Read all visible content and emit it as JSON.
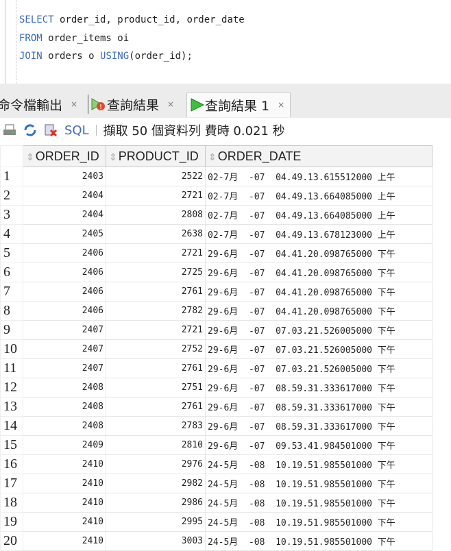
{
  "editor": {
    "lines": [
      [
        {
          "t": "SELECT",
          "kw": true
        },
        {
          "t": " order_id, product_id, order_date",
          "kw": false
        }
      ],
      [
        {
          "t": "FROM",
          "kw": true
        },
        {
          "t": " order_items oi",
          "kw": false
        }
      ],
      [
        {
          "t": "JOIN",
          "kw": true
        },
        {
          "t": " orders o ",
          "kw": false
        },
        {
          "t": "USING",
          "kw": true
        },
        {
          "t": "(order_id);",
          "kw": false
        }
      ]
    ]
  },
  "tabs": [
    {
      "label": "命令檔輸出",
      "icon": "none",
      "close": "×"
    },
    {
      "label": "查詢結果",
      "icon": "query-error-icon",
      "close": "×"
    },
    {
      "label": "查詢結果 1",
      "icon": "run-icon",
      "close": "×",
      "active": true
    }
  ],
  "toolbar": {
    "sql_label": "SQL",
    "status": "擷取 50 個資料列 費時 0.021 秒"
  },
  "columns": [
    "ORDER_ID",
    "PRODUCT_ID",
    "ORDER_DATE"
  ],
  "rows": [
    [
      "1",
      "2403",
      "2522",
      "02-7月  -07  04.49.13.615512000 上午"
    ],
    [
      "2",
      "2404",
      "2721",
      "02-7月  -07  04.49.13.664085000 上午"
    ],
    [
      "3",
      "2404",
      "2808",
      "02-7月  -07  04.49.13.664085000 上午"
    ],
    [
      "4",
      "2405",
      "2638",
      "02-7月  -07  04.49.13.678123000 上午"
    ],
    [
      "5",
      "2406",
      "2721",
      "29-6月  -07  04.41.20.098765000 下午"
    ],
    [
      "6",
      "2406",
      "2725",
      "29-6月  -07  04.41.20.098765000 下午"
    ],
    [
      "7",
      "2406",
      "2761",
      "29-6月  -07  04.41.20.098765000 下午"
    ],
    [
      "8",
      "2406",
      "2782",
      "29-6月  -07  04.41.20.098765000 下午"
    ],
    [
      "9",
      "2407",
      "2721",
      "29-6月  -07  07.03.21.526005000 下午"
    ],
    [
      "10",
      "2407",
      "2752",
      "29-6月  -07  07.03.21.526005000 下午"
    ],
    [
      "11",
      "2407",
      "2761",
      "29-6月  -07  07.03.21.526005000 下午"
    ],
    [
      "12",
      "2408",
      "2751",
      "29-6月  -07  08.59.31.333617000 下午"
    ],
    [
      "13",
      "2408",
      "2761",
      "29-6月  -07  08.59.31.333617000 下午"
    ],
    [
      "14",
      "2408",
      "2783",
      "29-6月  -07  08.59.31.333617000 下午"
    ],
    [
      "15",
      "2409",
      "2810",
      "29-6月  -07  09.53.41.984501000 下午"
    ],
    [
      "16",
      "2410",
      "2976",
      "24-5月  -08  10.19.51.985501000 下午"
    ],
    [
      "17",
      "2410",
      "2982",
      "24-5月  -08  10.19.51.985501000 下午"
    ],
    [
      "18",
      "2410",
      "2986",
      "24-5月  -08  10.19.51.985501000 下午"
    ],
    [
      "19",
      "2410",
      "2995",
      "24-5月  -08  10.19.51.985501000 下午"
    ],
    [
      "20",
      "2410",
      "3003",
      "24-5月  -08  10.19.51.985501000 下午"
    ]
  ]
}
